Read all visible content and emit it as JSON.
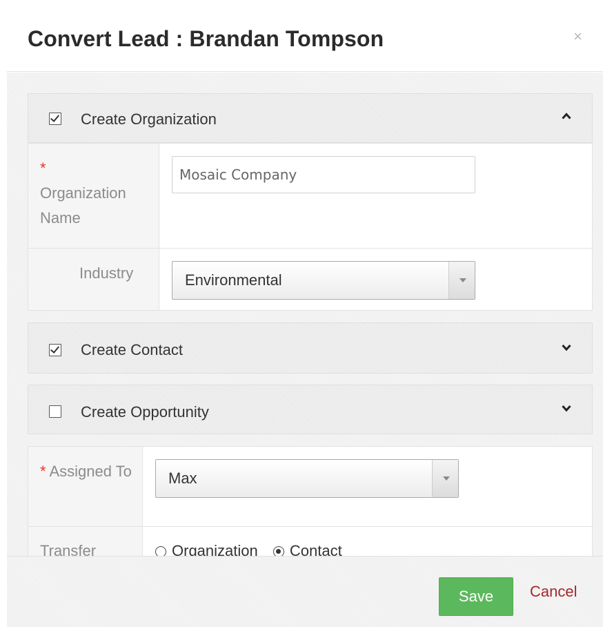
{
  "dialog": {
    "title": "Convert Lead : Brandan Tompson",
    "close_label": "×"
  },
  "sections": {
    "organization": {
      "title": "Create Organization",
      "checked": true,
      "expanded": true,
      "fields": {
        "org_name": {
          "required_mark": "*",
          "label": "Organization Name",
          "placeholder": "Mosaic Company"
        },
        "industry": {
          "label": "Industry",
          "value": "Environmental"
        }
      }
    },
    "contact": {
      "title": "Create Contact",
      "checked": true,
      "expanded": false
    },
    "opportunity": {
      "title": "Create Opportunity",
      "checked": false,
      "expanded": false
    }
  },
  "assignment": {
    "assigned_to": {
      "required_mark": "*",
      "label": "Assigned To",
      "value": "Max"
    },
    "transfer": {
      "label": "Transfer",
      "options": [
        {
          "label": "Organization",
          "selected": false
        },
        {
          "label": "Contact",
          "selected": true
        }
      ]
    }
  },
  "footer": {
    "save_label": "Save",
    "cancel_label": "Cancel"
  },
  "colors": {
    "save_button": "#5cb85c",
    "cancel_link": "#a5272b",
    "required": "#ee3322"
  }
}
